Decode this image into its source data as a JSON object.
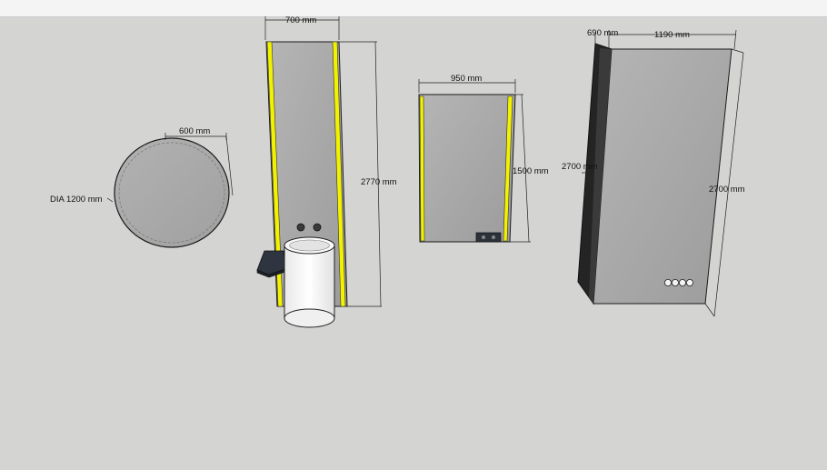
{
  "dimensions": {
    "round_mirror_dia": "DIA 1200 mm",
    "round_mirror_radius": "600 mm",
    "tall_mirror_width": "700 mm",
    "tall_mirror_height": "2770 mm",
    "medium_mirror_width": "950 mm",
    "medium_mirror_height": "1500 mm",
    "cabinet_depth": "690 mm",
    "cabinet_width": "1190 mm",
    "cabinet_height_left": "2700 mm",
    "cabinet_height_right": "2700 mm"
  },
  "colors": {
    "background": "#d4d4d2",
    "panel_fill": "#a9a9a9",
    "led_strip": "#f2f200",
    "edge_stroke": "#1a1a1a",
    "cabinet_side": "#2a2a2a",
    "cylinder_fill": "#f2f2f2"
  }
}
